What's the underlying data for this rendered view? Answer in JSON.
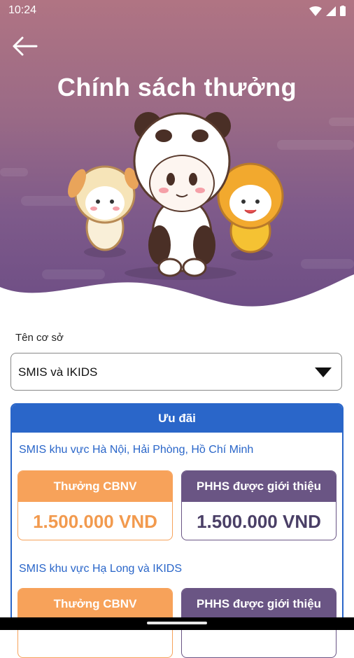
{
  "status": {
    "time": "10:24"
  },
  "header": {
    "title": "Chính sách thưởng"
  },
  "form": {
    "label": "Tên cơ sở",
    "selected": "SMIS và IKIDS"
  },
  "card": {
    "title": "Ưu đãi",
    "groups": [
      {
        "region": "SMIS khu vực Hà Nội, Hải Phòng, Hồ Chí Minh",
        "staff_label": "Thưởng CBNV",
        "staff_amount": "1.500.000 VND",
        "parent_label": "PHHS được giới thiệu",
        "parent_amount": "1.500.000 VND"
      },
      {
        "region": "SMIS khu vực Hạ Long và IKIDS",
        "staff_label": "Thưởng CBNV",
        "parent_label": "PHHS được giới thiệu"
      }
    ]
  },
  "colors": {
    "primary": "#2a66c9",
    "orange": "#f7a25a",
    "purple": "#6a5584",
    "hero_top": "#b07483",
    "hero_bottom": "#6a4b84"
  }
}
